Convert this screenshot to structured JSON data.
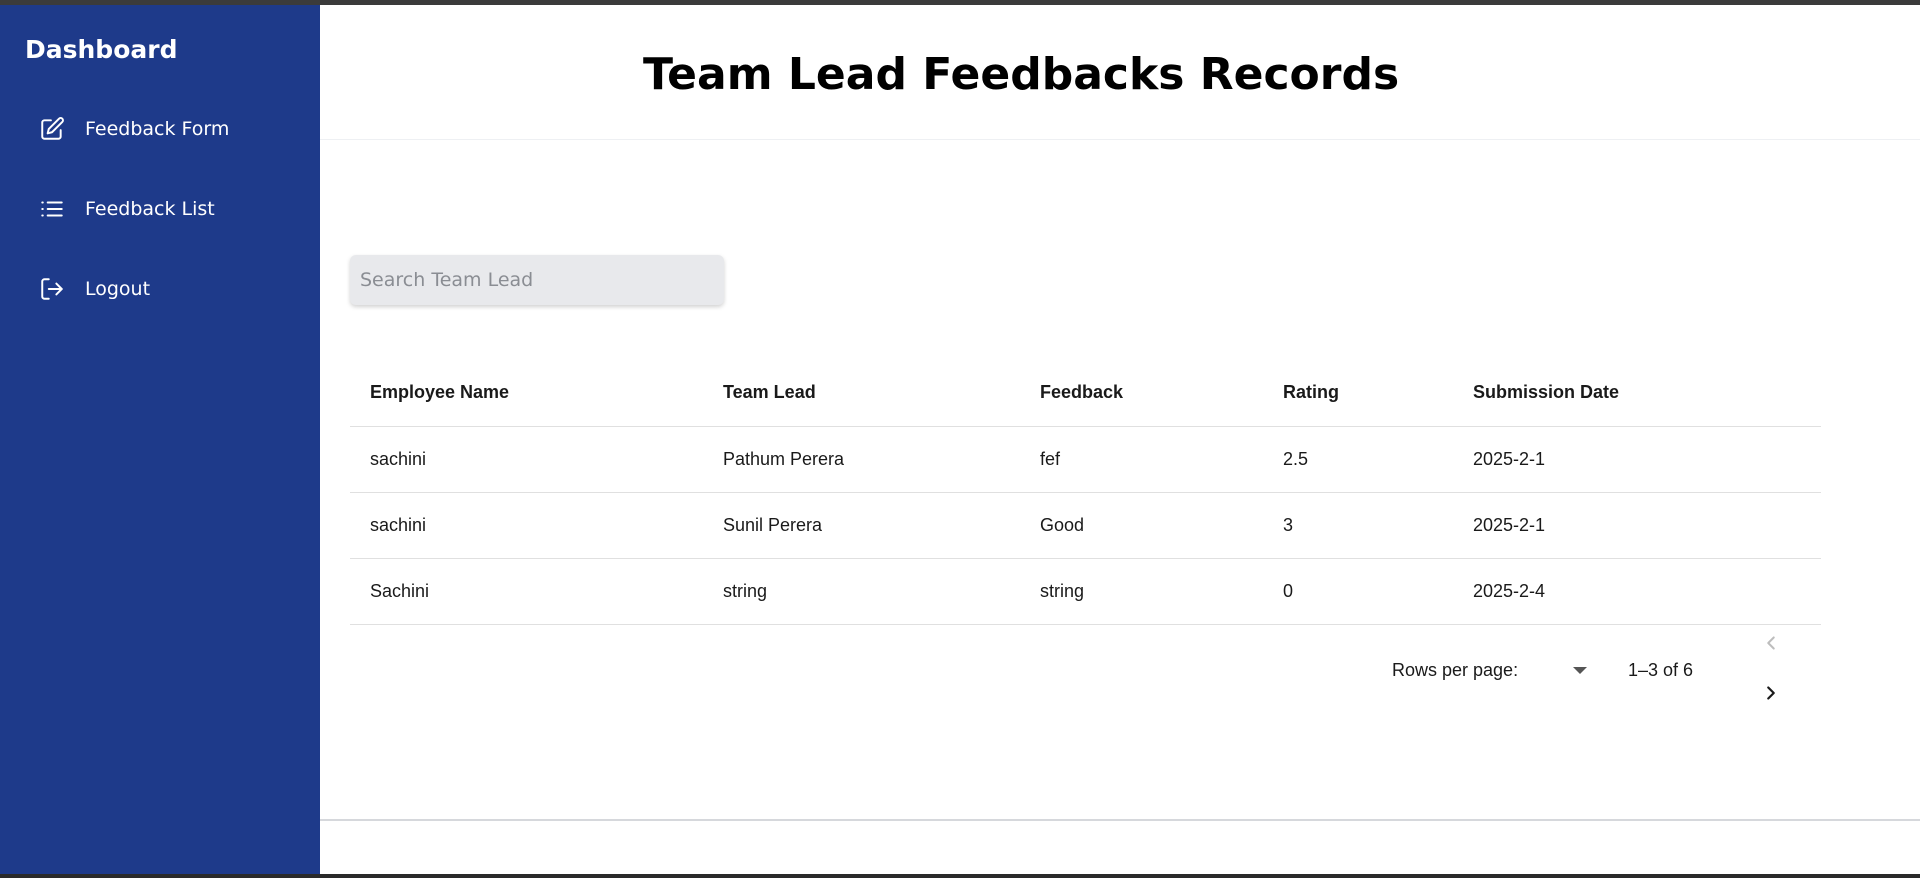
{
  "sidebar": {
    "title": "Dashboard",
    "items": [
      {
        "label": "Feedback Form",
        "icon": "edit-icon"
      },
      {
        "label": "Feedback List",
        "icon": "list-icon"
      },
      {
        "label": "Logout",
        "icon": "logout-icon"
      }
    ]
  },
  "header": {
    "title": "Team Lead Feedbacks Records"
  },
  "search": {
    "placeholder": "Search Team Lead",
    "value": ""
  },
  "table": {
    "columns": [
      "Employee Name",
      "Team Lead",
      "Feedback",
      "Rating",
      "Submission Date"
    ],
    "rows": [
      [
        "sachini",
        "Pathum Perera",
        "fef",
        "2.5",
        "2025-2-1"
      ],
      [
        "sachini",
        "Sunil Perera",
        "Good",
        "3",
        "2025-2-1"
      ],
      [
        "Sachini",
        "string",
        "string",
        "0",
        "2025-2-4"
      ]
    ]
  },
  "pagination": {
    "rows_per_page_label": "Rows per page:",
    "range": "1–3 of 6"
  },
  "colors": {
    "sidebar_bg": "#1e3a8a",
    "search_bg": "#e8e9ec"
  }
}
